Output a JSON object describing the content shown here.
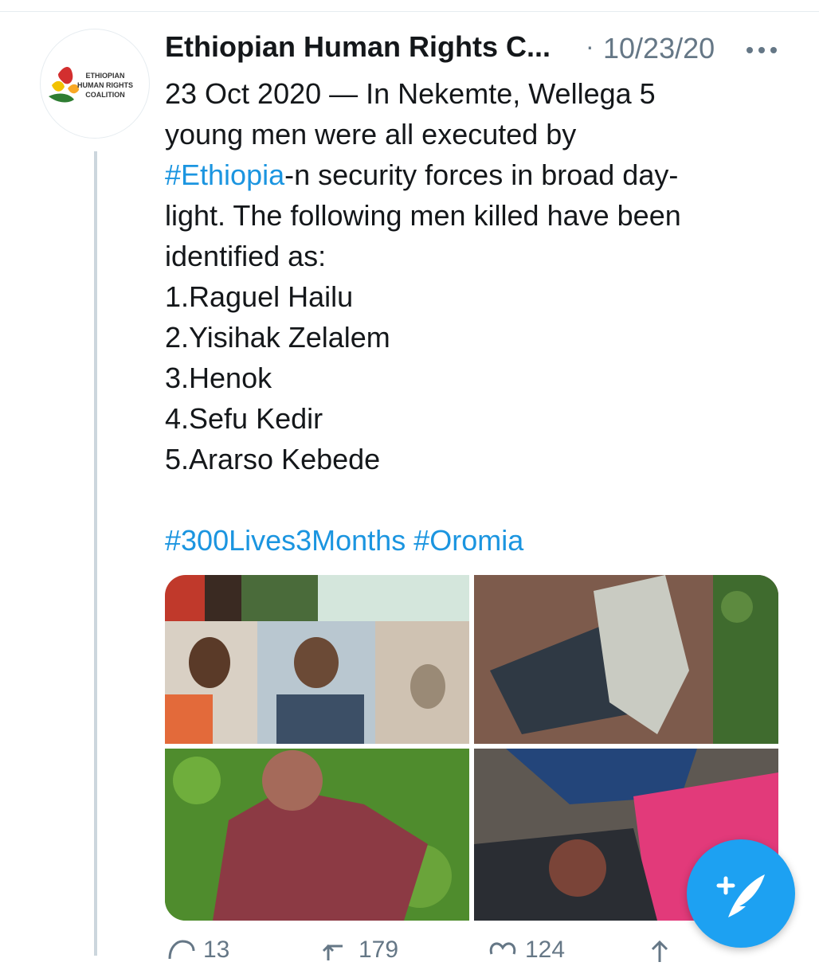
{
  "tweet": {
    "author_name": "Ethiopian Human Rights C...",
    "separator": "·",
    "date": "10/23/20",
    "avatar_text": [
      "ETHIOPIAN",
      "HUMAN RIGHTS",
      "COALITION"
    ],
    "text_lines": [
      [
        {
          "t": "23 Oct 2020 — In Nekemte, Wellega 5",
          "tag": false
        }
      ],
      [
        {
          "t": "young men were all executed by",
          "tag": false
        }
      ],
      [
        {
          "t": "#Ethiopia",
          "tag": true
        },
        {
          "t": "-n security forces in broad day-",
          "tag": false
        }
      ],
      [
        {
          "t": "light. The following men killed have been",
          "tag": false
        }
      ],
      [
        {
          "t": "identified as:",
          "tag": false
        }
      ],
      [
        {
          "t": "1.Raguel Hailu",
          "tag": false
        }
      ],
      [
        {
          "t": "2.Yisihak Zelalem",
          "tag": false
        }
      ],
      [
        {
          "t": "3.Henok",
          "tag": false
        }
      ],
      [
        {
          "t": "4.Sefu Kedir",
          "tag": false
        }
      ],
      [
        {
          "t": "5.Ararso Kebede",
          "tag": false
        }
      ],
      [
        {
          "t": "",
          "tag": false
        }
      ],
      [
        {
          "t": "#300Lives3Months",
          "tag": true
        },
        {
          "t": " ",
          "tag": false
        },
        {
          "t": "#Oromia",
          "tag": true
        }
      ]
    ],
    "media_count": 4,
    "actions": {
      "reply_count": "13",
      "retweet_count": "179",
      "like_count": "124"
    }
  },
  "colors": {
    "hashtag": "#1b95e0",
    "secondary_text": "#657786",
    "fab": "#1da1f2"
  },
  "icons": {
    "more": "more-dots-icon",
    "reply": "reply-icon",
    "retweet": "retweet-icon",
    "like": "heart-icon",
    "share": "share-icon",
    "compose": "compose-tweet-icon"
  }
}
